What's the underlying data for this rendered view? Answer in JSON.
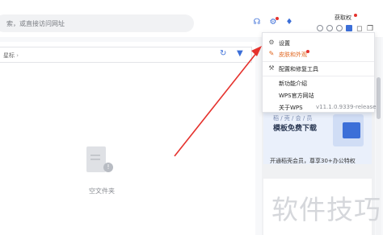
{
  "topbar": {
    "search_placeholder": "索，或直接访问网址",
    "user_name": "获取权",
    "icons": [
      "headset-icon",
      "settings-badge-icon",
      "skin-icon"
    ]
  },
  "filepane": {
    "breadcrumb": "星标",
    "empty_label": "空文件夹"
  },
  "menu": {
    "items": [
      {
        "icon": "gear-icon",
        "label": "设置"
      },
      {
        "icon": "brush-icon",
        "label": "皮肤和外观"
      },
      {
        "icon": "wrench-icon",
        "label": "配置和修复工具"
      },
      {
        "icon": "",
        "label": "新功能介绍"
      },
      {
        "icon": "",
        "label": "WPS官方网站"
      },
      {
        "icon": "",
        "label": "关于WPS",
        "version": "v11.1.0.9339-release"
      }
    ]
  },
  "promo": {
    "small_text": "稻 / 壳 / 会 / 员",
    "big_text": "模板免费下载",
    "cta": "开通稻壳会员，尊享30+办公特权"
  },
  "watermark": "软件技巧",
  "colors": {
    "accent": "#3c6fd8",
    "arrow": "#e5322d",
    "skin_label": "#e0661f"
  }
}
